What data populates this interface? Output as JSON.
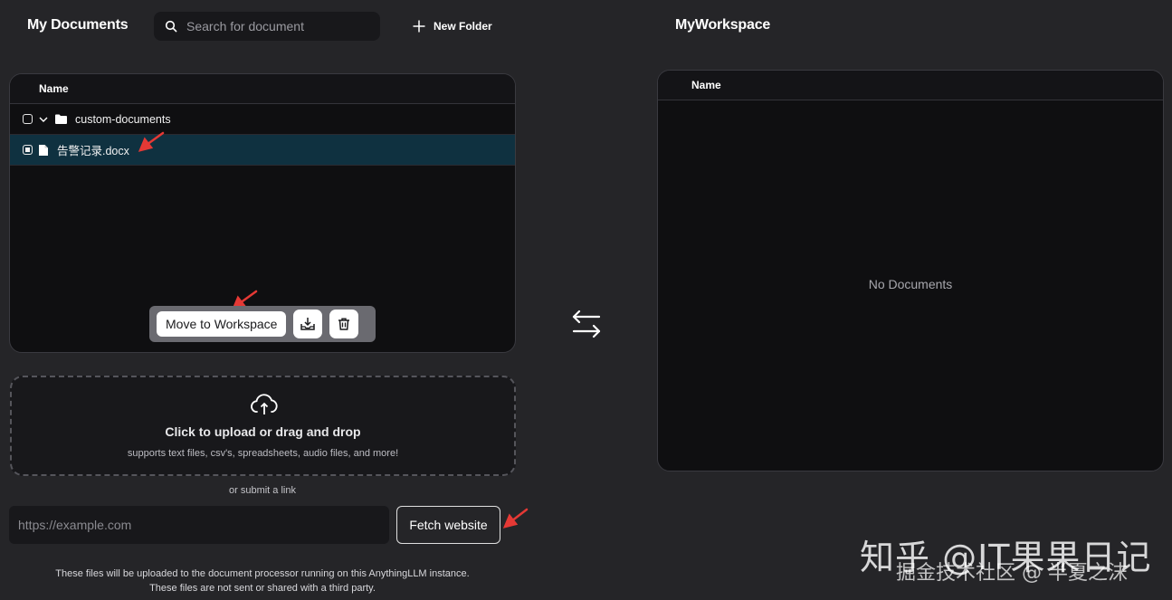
{
  "left": {
    "title": "My Documents",
    "search_placeholder": "Search for document",
    "new_folder_label": "New Folder",
    "table_header": "Name",
    "rows": [
      {
        "label": "custom-documents",
        "type": "folder",
        "icon": "folder-icon",
        "selected": false
      },
      {
        "label": "告警记录.docx",
        "type": "file",
        "icon": "file-icon",
        "selected": true
      }
    ],
    "action_bar": {
      "move_label": "Move to Workspace",
      "embed_icon": "embed-tray-icon",
      "delete_icon": "trash-icon"
    }
  },
  "upload": {
    "icon": "cloud-upload-icon",
    "title": "Click to upload or drag and drop",
    "subtitle": "supports text files, csv's, spreadsheets, audio files, and more!",
    "or_link": "or submit a link",
    "url_placeholder": "https://example.com",
    "fetch_label": "Fetch website",
    "note_line1": "These files will be uploaded to the document processor running on this AnythingLLM instance.",
    "note_line2": "These files are not sent or shared with a third party."
  },
  "transfer_icon": "swap-arrows-icon",
  "right": {
    "title": "MyWorkspace",
    "table_header": "Name",
    "empty_text": "No Documents"
  },
  "watermark": {
    "line1": "知乎 @IT果果日记",
    "line2": "掘金技术社区 @ 半夏之沫"
  },
  "colors": {
    "background": "#252528",
    "panel": "#0f0f11",
    "selected_row": "#0f3140",
    "annotation_arrow": "#e53935"
  }
}
